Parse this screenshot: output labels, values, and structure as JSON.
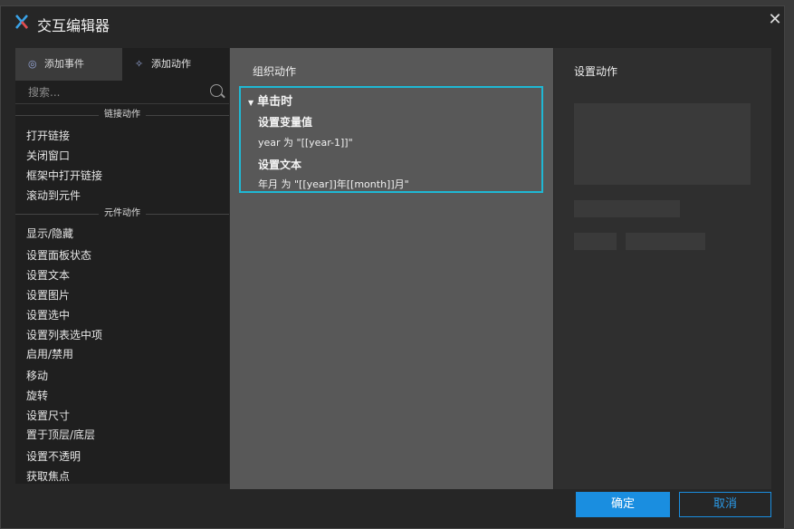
{
  "window": {
    "title": "交互编辑器"
  },
  "left": {
    "tabs": [
      {
        "label": "添加事件"
      },
      {
        "label": "添加动作"
      }
    ],
    "search_placeholder": "搜索...",
    "sections": [
      {
        "header": "链接动作",
        "items": [
          "打开链接",
          "关闭窗口",
          "框架中打开链接",
          "滚动到元件"
        ]
      },
      {
        "header": "元件动作",
        "items": [
          "显示/隐藏",
          "设置面板状态",
          "设置文本",
          "设置图片",
          "设置选中",
          "设置列表选中项",
          "启用/禁用",
          "移动",
          "旋转",
          "设置尺寸",
          "置于顶层/底层",
          "设置不透明",
          "获取焦点"
        ]
      }
    ]
  },
  "middle": {
    "title": "组织动作",
    "event": {
      "label": "单击时",
      "actions": [
        {
          "name": "设置变量值",
          "detail": "year 为 \"[[year-1]]\""
        },
        {
          "name": "设置文本",
          "detail": "年月 为 \"[[year]]年[[month]]月\""
        }
      ]
    }
  },
  "right": {
    "title": "设置动作"
  },
  "footer": {
    "ok_label": "确定",
    "cancel_label": "取消"
  },
  "colors": {
    "accent": "#1fb8d4",
    "primary_button": "#1a8ee0"
  }
}
